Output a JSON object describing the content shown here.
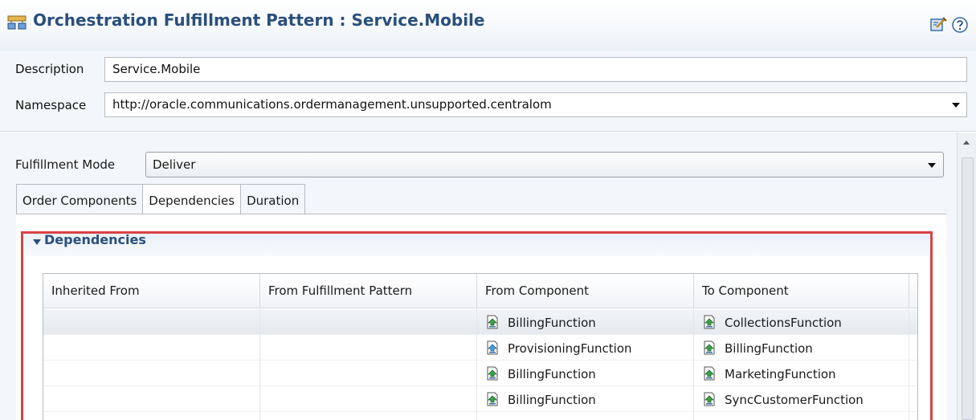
{
  "header": {
    "title": "Orchestration Fulfillment Pattern : Service.Mobile",
    "icons": [
      "pattern-icon",
      "dynamic-help-icon",
      "help-icon"
    ],
    "title_color": "#2a4f7c"
  },
  "form": {
    "description_label": "Description",
    "description_value": "Service.Mobile",
    "namespace_label": "Namespace",
    "namespace_value": "http://oracle.communications.ordermanagement.unsupported.centralom"
  },
  "fulfillment": {
    "mode_label": "Fulfillment Mode",
    "mode_value": "Deliver"
  },
  "tabs": [
    {
      "label": "Order Components",
      "active": false
    },
    {
      "label": "Dependencies",
      "active": true
    },
    {
      "label": "Duration",
      "active": false
    }
  ],
  "dependencies": {
    "section_title": "Dependencies",
    "columns": [
      "Inherited From",
      "From Fulfillment Pattern",
      "From Component",
      "To Component"
    ],
    "rows": [
      {
        "inherited_from": "",
        "from_pattern": "",
        "from_component": "BillingFunction",
        "to_component": "CollectionsFunction",
        "from_icon": "component-green-icon",
        "to_icon": "component-green-icon"
      },
      {
        "inherited_from": "",
        "from_pattern": "",
        "from_component": "ProvisioningFunction",
        "to_component": "BillingFunction",
        "from_icon": "component-blue-icon",
        "to_icon": "component-green-icon"
      },
      {
        "inherited_from": "",
        "from_pattern": "",
        "from_component": "BillingFunction",
        "to_component": "MarketingFunction",
        "from_icon": "component-green-icon",
        "to_icon": "component-green-icon"
      },
      {
        "inherited_from": "",
        "from_pattern": "",
        "from_component": "BillingFunction",
        "to_component": "SyncCustomerFunction",
        "from_icon": "component-green-icon",
        "to_icon": "component-green-icon"
      }
    ]
  },
  "colors": {
    "accent": "#2a4f7c",
    "highlight_border": "#d94343",
    "panel_bg": "#f3f6fa"
  }
}
